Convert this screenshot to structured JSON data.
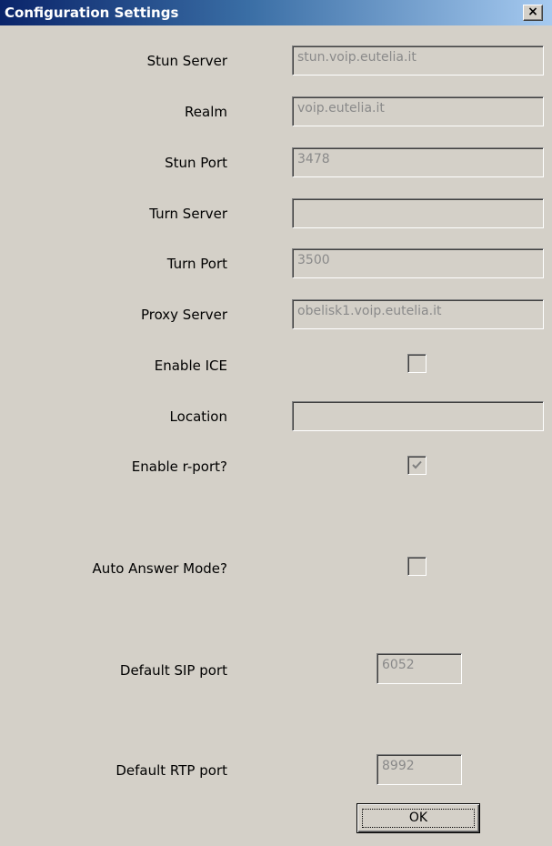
{
  "window": {
    "title": "Configuration Settings",
    "close_glyph": "×"
  },
  "fields": {
    "stun_server": {
      "label": "Stun Server",
      "value": "stun.voip.eutelia.it"
    },
    "realm": {
      "label": "Realm",
      "value": "voip.eutelia.it"
    },
    "stun_port": {
      "label": "Stun Port",
      "value": "3478"
    },
    "turn_server": {
      "label": "Turn Server",
      "value": ""
    },
    "turn_port": {
      "label": "Turn Port",
      "value": "3500"
    },
    "proxy_server": {
      "label": "Proxy Server",
      "value": "obelisk1.voip.eutelia.it"
    },
    "enable_ice": {
      "label": "Enable ICE",
      "checked": false
    },
    "location": {
      "label": "Location",
      "value": ""
    },
    "enable_rport": {
      "label": "Enable r-port?",
      "checked": true
    },
    "auto_answer": {
      "label": "Auto Answer Mode?",
      "checked": false
    },
    "default_sip_port": {
      "label": "Default SIP port",
      "value": "6052"
    },
    "default_rtp_port": {
      "label": "Default RTP port",
      "value": "8992"
    }
  },
  "buttons": {
    "ok_label": "OK"
  }
}
